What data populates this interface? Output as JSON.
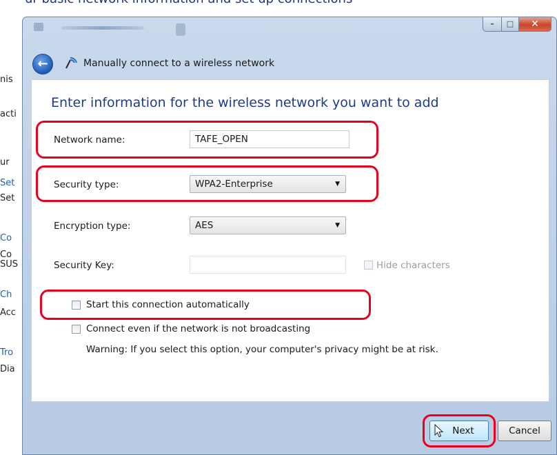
{
  "background_page": {
    "header_text": "ur basic network information and set up connections",
    "side_fragments": [
      "SUS",
      "nis",
      "acti",
      "ur",
      "Set",
      "Set",
      "Co",
      "Co",
      "Ch",
      "Acc",
      "Tro",
      "Dia"
    ]
  },
  "window": {
    "title_buttons": {
      "minimize": "–",
      "maximize": "□",
      "close": "✕"
    },
    "nav": {
      "back_label": "←",
      "title": "Manually connect to a wireless network"
    }
  },
  "form": {
    "heading": "Enter information for the wireless network you want to add",
    "network_name": {
      "label": "Network name:",
      "value": "TAFE_OPEN"
    },
    "security_type": {
      "label": "Security type:",
      "value": "WPA2-Enterprise"
    },
    "encryption_type": {
      "label": "Encryption type:",
      "value": "AES"
    },
    "security_key": {
      "label": "Security Key:",
      "value": ""
    },
    "hide_characters": {
      "label": "Hide characters",
      "checked": false,
      "enabled": false
    },
    "start_automatically": {
      "label": "Start this connection automatically",
      "checked": false
    },
    "connect_not_broadcasting": {
      "label": "Connect even if the network is not broadcasting",
      "checked": false
    },
    "warning": "Warning: If you select this option, your computer's privacy might be at risk."
  },
  "buttons": {
    "next": "Next",
    "cancel": "Cancel"
  },
  "colors": {
    "highlight": "#e8001c",
    "heading": "#1e3a8a",
    "window_frame": "#bcd0e8"
  }
}
